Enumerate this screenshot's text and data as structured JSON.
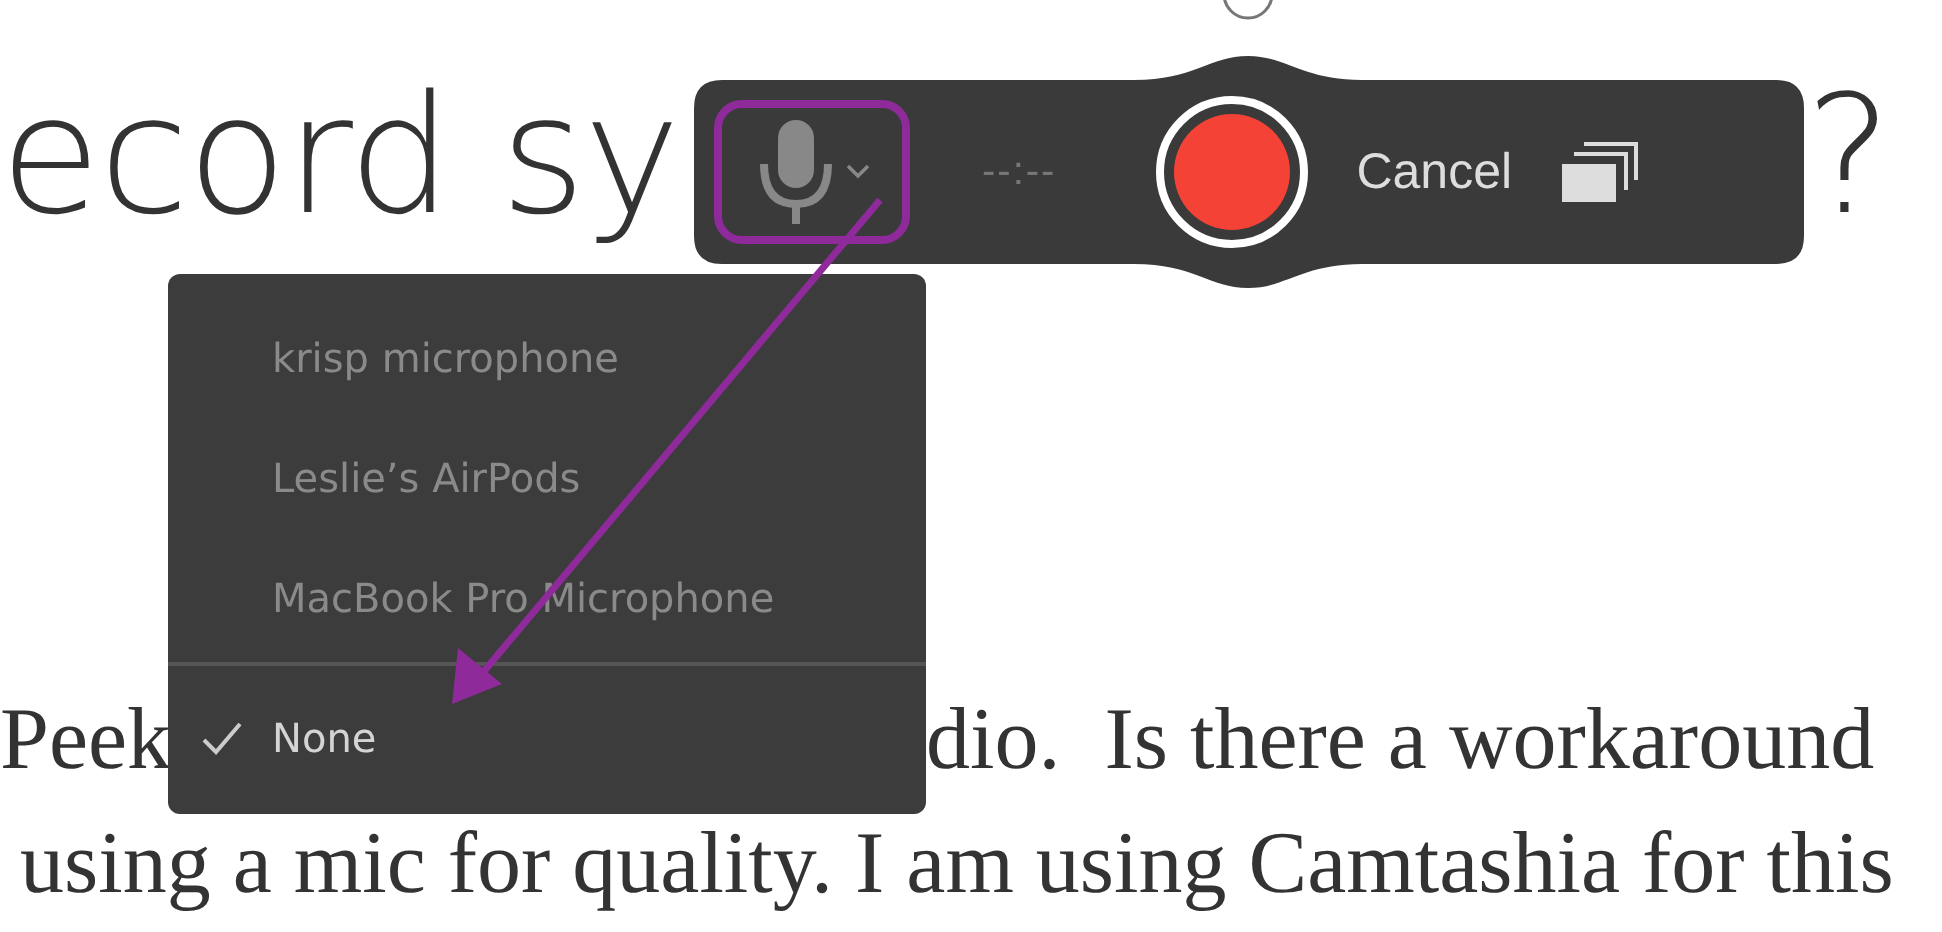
{
  "heading": {
    "parts": [
      "ecord sy",
      "?"
    ]
  },
  "toolbar": {
    "timer": "--:--",
    "cancel": "Cancel",
    "recording": false
  },
  "mic_menu": {
    "open": true,
    "items": [
      {
        "label": "krisp microphone",
        "selected": false
      },
      {
        "label": "Leslie’s AirPods",
        "selected": false
      },
      {
        "label": "MacBook Pro Microphone",
        "selected": false
      },
      {
        "label": "None",
        "selected": true
      }
    ]
  },
  "paragraph": {
    "lines": [
      [
        "Peek",
        "dio.  Is there a workaround"
      ],
      [
        "using a mic for quality. I am using Camtashia for this"
      ]
    ]
  }
}
